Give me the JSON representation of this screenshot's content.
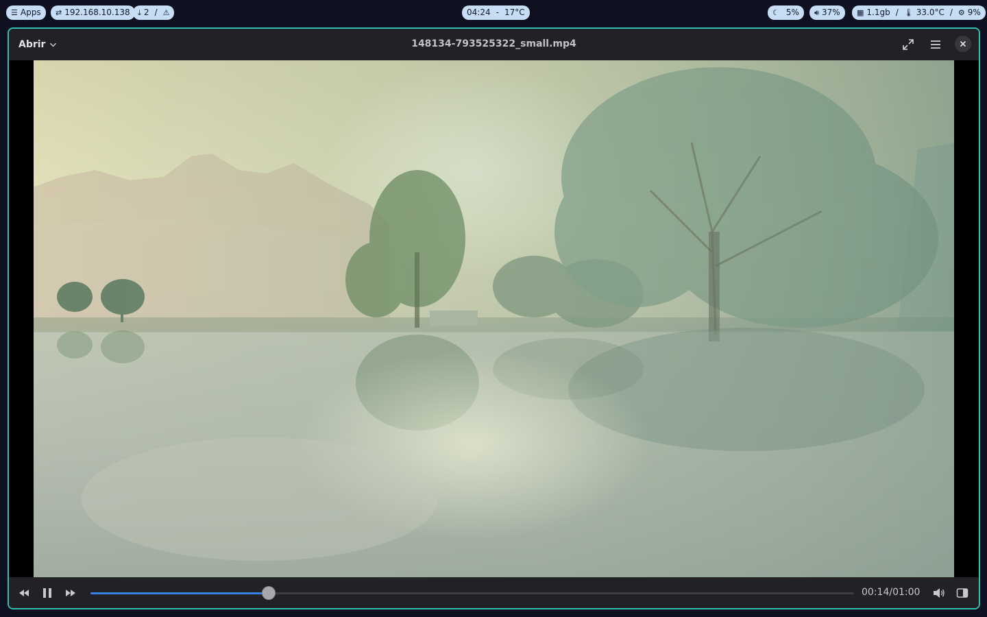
{
  "topbar": {
    "apps_label": "Apps",
    "ip": "192.168.10.138",
    "downloads_count": "2",
    "downloads_sep": "/",
    "clock": "04:24",
    "clock_sep": "-",
    "weather": "17°C",
    "brightness": "5%",
    "volume": "37%",
    "memory": "1.1gb",
    "mem_sep": "/",
    "temperature": "33.0°C",
    "temp_sep": "/",
    "cpu": "9%"
  },
  "window": {
    "open_label": "Abrir",
    "title": "148134-793525322_small.mp4"
  },
  "player": {
    "current_time": "00:14",
    "duration": "01:00",
    "time_display": "00:14/01:00",
    "progress": 0.2333
  },
  "colors": {
    "accent": "#3584e4",
    "window_border": "#33c0b0",
    "pill_bg": "#c7ddf6"
  }
}
